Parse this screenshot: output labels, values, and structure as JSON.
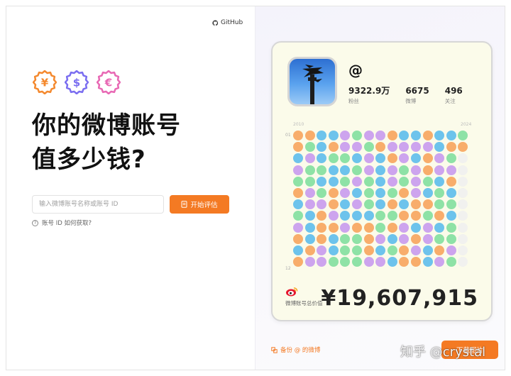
{
  "header": {
    "github_label": "GitHub"
  },
  "hero": {
    "coins": [
      {
        "symbol": "¥",
        "color": "#f4892e",
        "icon": "yuan-coin-icon"
      },
      {
        "symbol": "$",
        "color": "#7a6df0",
        "icon": "dollar-coin-icon"
      },
      {
        "symbol": "€",
        "color": "#e868b4",
        "icon": "euro-coin-icon"
      }
    ],
    "title_line1": "你的微博账号",
    "title_line2": "值多少钱?"
  },
  "search": {
    "placeholder": "输入微博账号名称或账号 ID",
    "value": ""
  },
  "start_button": {
    "label": "开始评估",
    "icon": "document-icon"
  },
  "help": {
    "label": "账号 ID 如何获取?",
    "icon": "question-icon"
  },
  "card": {
    "handle": "@",
    "stats": [
      {
        "value": "9322.9万",
        "label": "粉丝"
      },
      {
        "value": "6675",
        "label": "微博"
      },
      {
        "value": "496",
        "label": "关注"
      }
    ],
    "year_start": "2010",
    "year_end": "2024",
    "row_label_top": "01",
    "row_label_bottom": "12",
    "value_label": "微博账号总价值",
    "value": "¥19,607,915",
    "colors": {
      "O": "#f8ad6b",
      "B": "#6dc3ec",
      "P": "#cda4ee",
      "G": "#8ee2a6",
      "E": "#f1f1ef"
    },
    "grid_rows": [
      "OOBBPGPPOBBOBBG",
      "OGBOPPGOPPPPBOO",
      "BPBGGBPBOPBOPGE",
      "PGGBBGPBPGPOPPE",
      "GGBBGPGBPGPGBOE",
      "OPGOPBGBGOPBGBE",
      "BPPOBPGBOBOOGGE",
      "GBOPBBBGGOOGOBE",
      "PBOOPOOGOPBPBGE",
      "OBOBGGOPBPOPGGE",
      "BOPBGGOBGOPBOPE",
      "OPPGGGPPBOOBPGE"
    ]
  },
  "footer": {
    "backup_label": "备份 @ 的微博",
    "download_label": "下载图片"
  },
  "watermark": "知乎 @crystal"
}
